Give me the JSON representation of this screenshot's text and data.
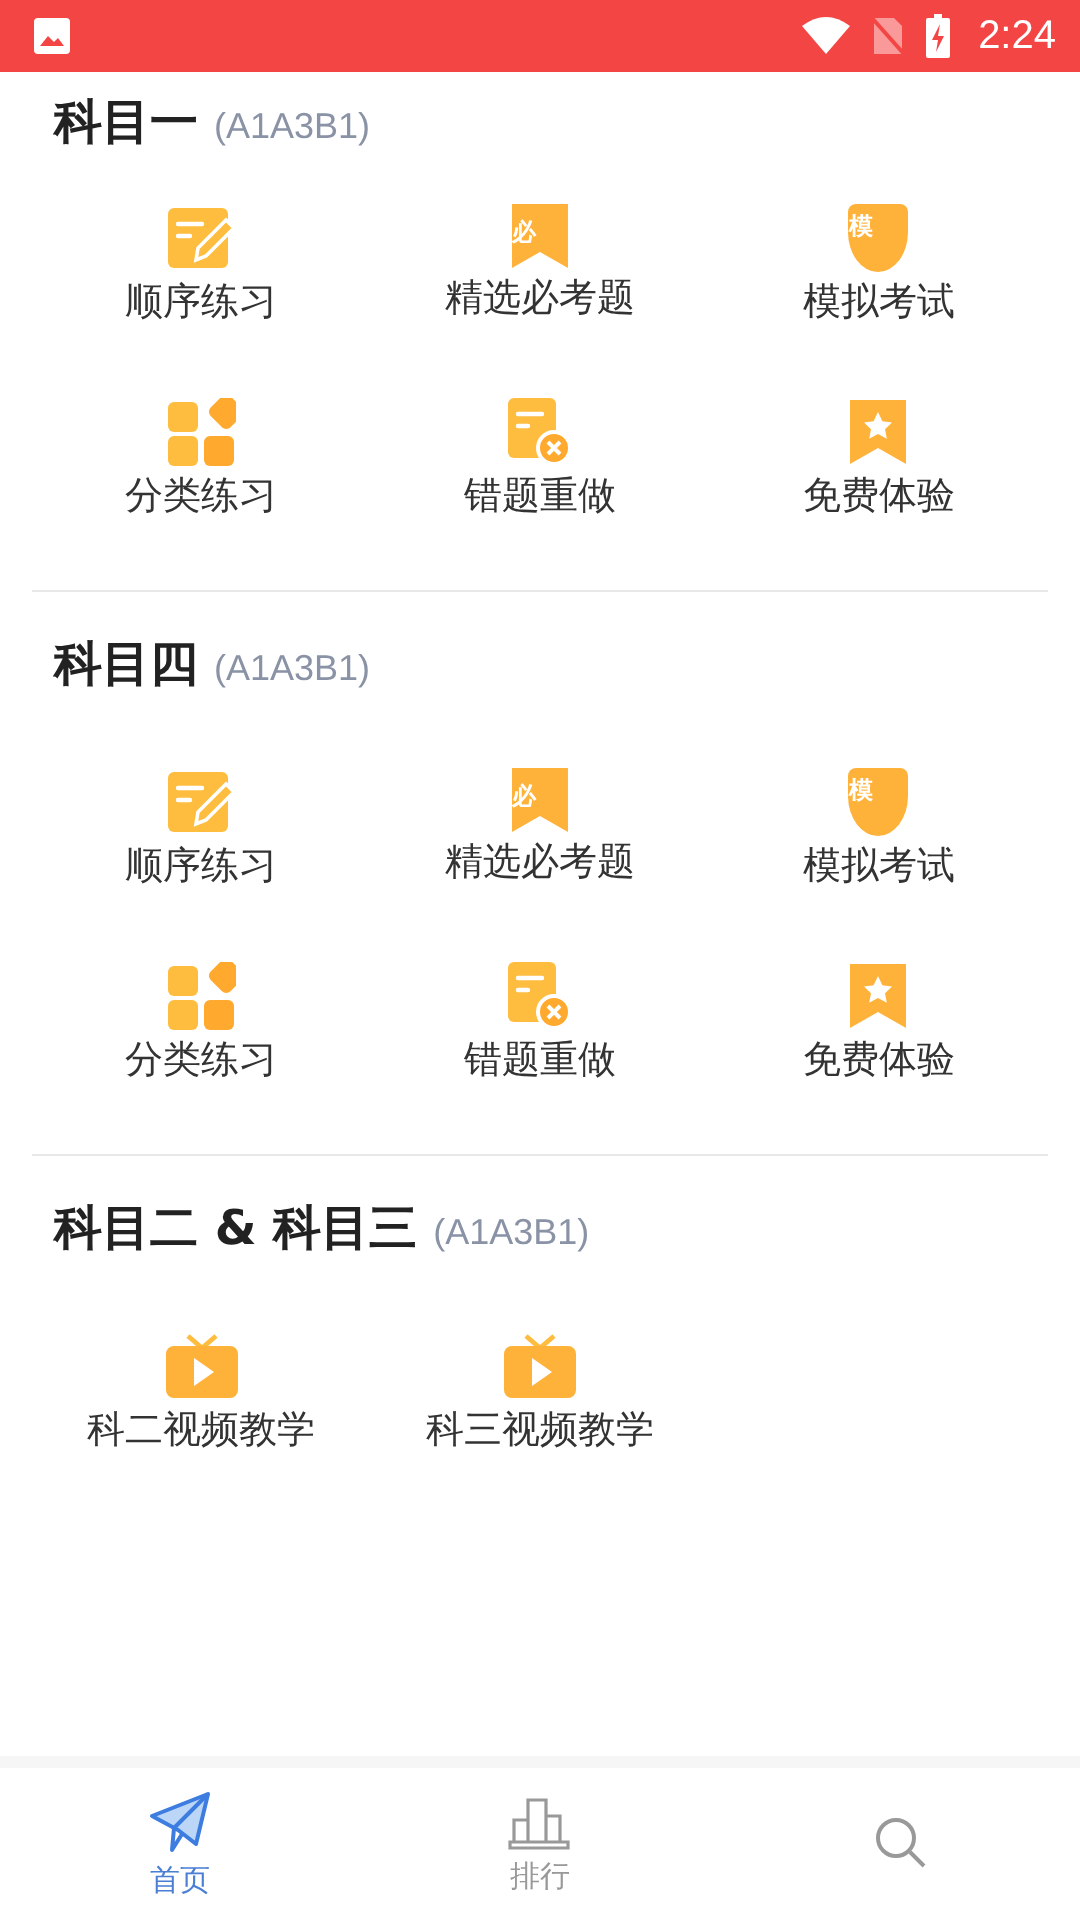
{
  "status_bar": {
    "time": "2:24"
  },
  "sections": [
    {
      "title": "科目一",
      "subtitle": "(A1A3B1)",
      "items": [
        {
          "kind": "pencil",
          "label": "顺序练习"
        },
        {
          "kind": "bookmark",
          "icon_text": "必",
          "label": "精选必考题"
        },
        {
          "kind": "shield",
          "icon_text": "模",
          "label": "模拟考试"
        },
        {
          "kind": "grid",
          "label": "分类练习"
        },
        {
          "kind": "wrong",
          "label": "错题重做"
        },
        {
          "kind": "star",
          "label": "免费体验"
        }
      ]
    },
    {
      "title": "科目四",
      "subtitle": "(A1A3B1)",
      "items": [
        {
          "kind": "pencil",
          "label": "顺序练习"
        },
        {
          "kind": "bookmark",
          "icon_text": "必",
          "label": "精选必考题"
        },
        {
          "kind": "shield",
          "icon_text": "模",
          "label": "模拟考试"
        },
        {
          "kind": "grid",
          "label": "分类练习"
        },
        {
          "kind": "wrong",
          "label": "错题重做"
        },
        {
          "kind": "star",
          "label": "免费体验"
        }
      ]
    },
    {
      "title": "科目二 & 科目三",
      "subtitle": "(A1A3B1)",
      "items": [
        {
          "kind": "tv",
          "label": "科二视频教学"
        },
        {
          "kind": "tv",
          "label": "科三视频教学"
        }
      ]
    }
  ],
  "bottom_nav": [
    {
      "kind": "plane",
      "label": "首页",
      "selected": true
    },
    {
      "kind": "chart",
      "label": "排行",
      "selected": false
    },
    {
      "kind": "search",
      "selected": false
    }
  ]
}
